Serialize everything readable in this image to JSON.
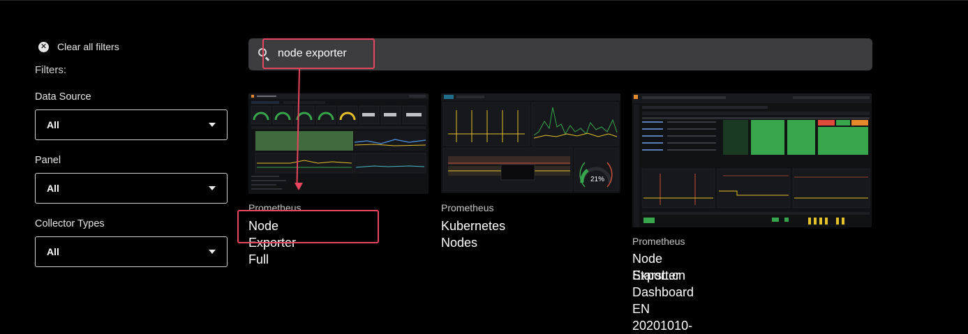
{
  "sidebar": {
    "clear_all_label": "Clear all filters",
    "filters_title": "Filters:",
    "filters": [
      {
        "label": "Data Source",
        "value": "All"
      },
      {
        "label": "Panel",
        "value": "All"
      },
      {
        "label": "Collector Types",
        "value": "All"
      }
    ]
  },
  "search": {
    "query": "node exporter",
    "placeholder": ""
  },
  "results": [
    {
      "source": "Prometheus",
      "title": "Node Exporter Full"
    },
    {
      "source": "Prometheus",
      "title": "Kubernetes Nodes"
    },
    {
      "source": "Prometheus",
      "title_line1": "Node Exporter Dashboard EN 20201010-",
      "title_line2": "StarsL.cn"
    }
  ],
  "thumb2": {
    "gauge_value": "21%"
  },
  "colors": {
    "highlight": "#e8455f",
    "search_bg": "#3d3d40",
    "grafana_green": "#37a64d",
    "grafana_yellow": "#e5c12a"
  }
}
